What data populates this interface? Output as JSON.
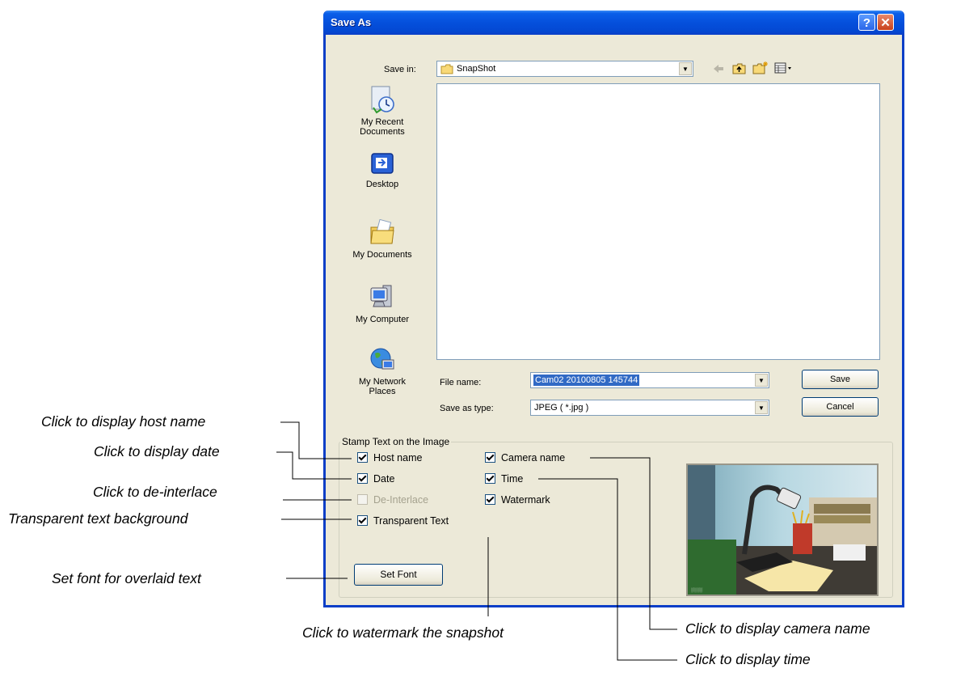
{
  "dialog": {
    "title": "Save As",
    "help_glyph": "?",
    "close_glyph": "✕"
  },
  "toolbar": {
    "save_in_label": "Save in:",
    "save_in_value": "SnapShot",
    "icons": [
      "back-arrow-icon",
      "up-folder-icon",
      "new-folder-icon",
      "view-menu-icon"
    ]
  },
  "places": [
    {
      "label": "My Recent Documents",
      "icon": "recent-documents-icon"
    },
    {
      "label": "Desktop",
      "icon": "desktop-icon"
    },
    {
      "label": "My Documents",
      "icon": "my-documents-icon"
    },
    {
      "label": "My Computer",
      "icon": "my-computer-icon"
    },
    {
      "label": "My Network Places",
      "icon": "network-places-icon"
    }
  ],
  "filename": {
    "label": "File name:",
    "value": "Cam02 20100805 145744"
  },
  "filetype": {
    "label": "Save as type:",
    "value": "JPEG ( *.jpg )"
  },
  "buttons": {
    "save": "Save",
    "cancel": "Cancel",
    "set_font": "Set Font"
  },
  "stamp": {
    "title": "Stamp Text on the Image",
    "options": [
      {
        "label": "Host name",
        "checked": true,
        "enabled": true
      },
      {
        "label": "Date",
        "checked": true,
        "enabled": true
      },
      {
        "label": "De-Interlace",
        "checked": false,
        "enabled": false
      },
      {
        "label": "Transparent Text",
        "checked": true,
        "enabled": true
      },
      {
        "label": "Camera name",
        "checked": true,
        "enabled": true
      },
      {
        "label": "Time",
        "checked": true,
        "enabled": true
      },
      {
        "label": "Watermark",
        "checked": true,
        "enabled": true
      }
    ]
  },
  "annotations": {
    "host_name": "Click to display host name",
    "date": "Click to display date",
    "deinterlace": "Click to de-interlace",
    "transparent": "Transparent text background",
    "set_font": "Set font for overlaid text",
    "watermark": "Click to watermark the snapshot",
    "camera_name": "Click to display camera name",
    "time": "Click to display time"
  },
  "colors": {
    "title_bar": "#0550dc",
    "dialog_face": "#ece9d8",
    "selection": "#316ac5"
  }
}
